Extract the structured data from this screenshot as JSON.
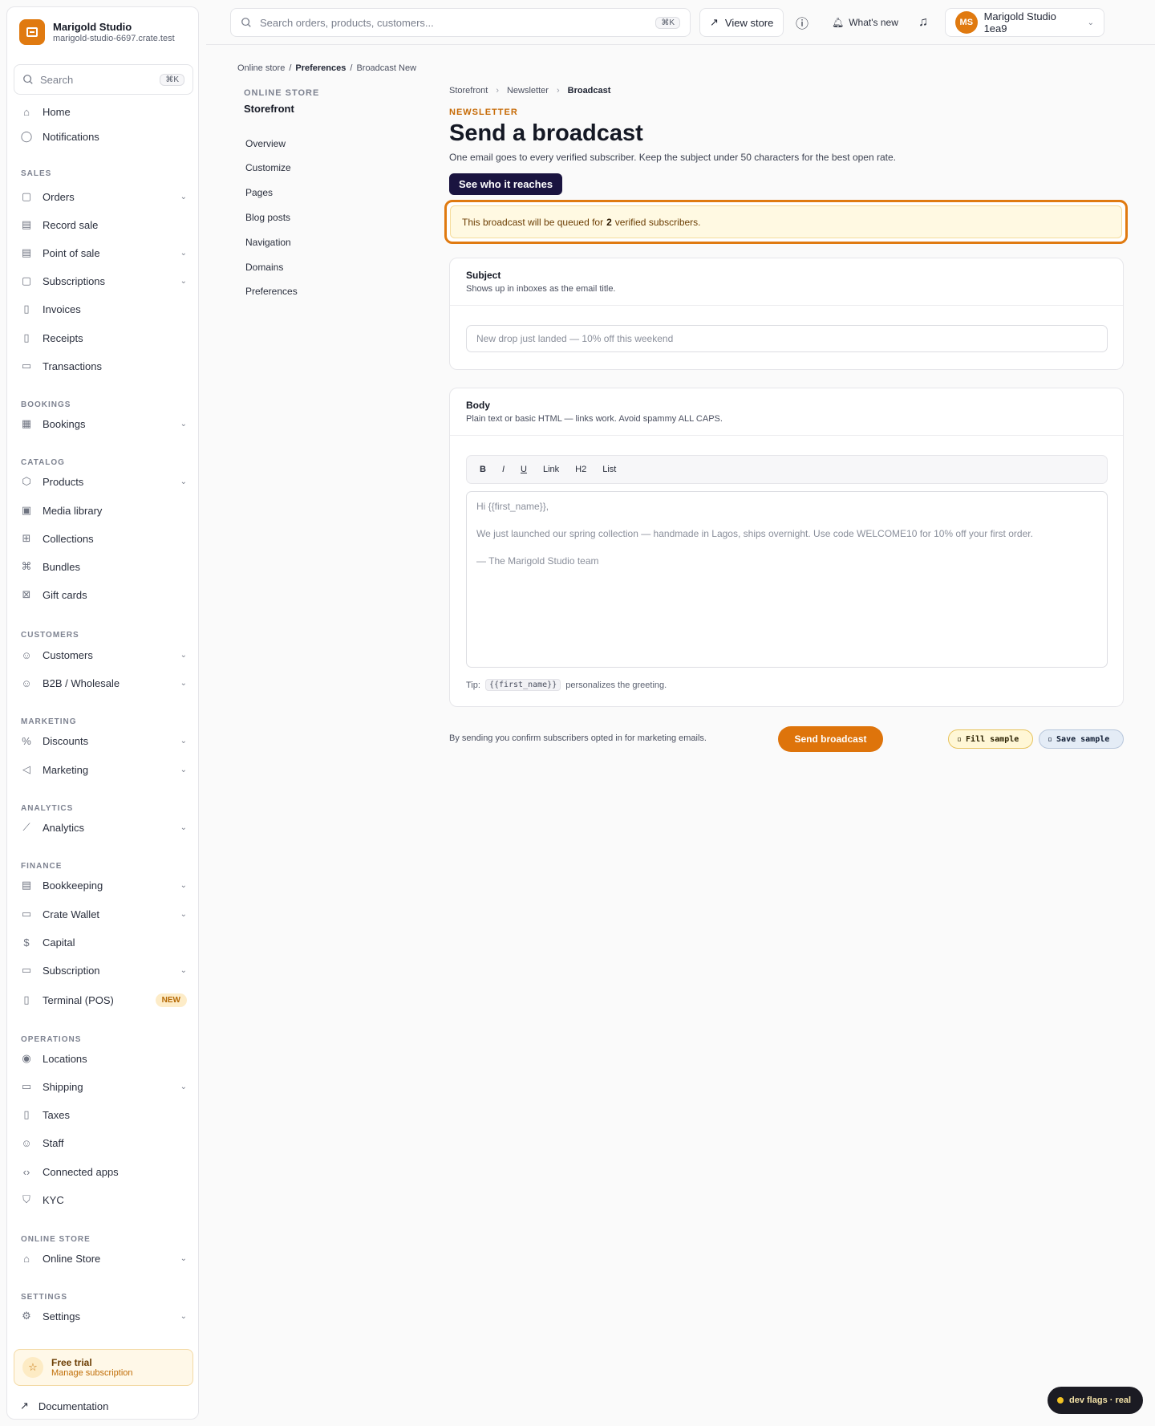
{
  "brand": {
    "name": "Marigold Studio",
    "domain": "marigold-studio-6697.crate.test"
  },
  "sidebar": {
    "search_placeholder": "Search",
    "search_shortcut": "⌘K",
    "items": [
      {
        "label": "Home",
        "icon": "home-icon"
      },
      {
        "label": "Notifications",
        "icon": "chat-icon"
      },
      {
        "label": "Orders",
        "icon": "bag-icon"
      },
      {
        "label": "Record sale",
        "icon": "receipt-icon"
      },
      {
        "label": "Point of sale",
        "icon": "receipt-icon"
      },
      {
        "label": "Subscriptions",
        "icon": "bag-icon"
      },
      {
        "label": "Invoices",
        "icon": "document-icon"
      },
      {
        "label": "Receipts",
        "icon": "document-icon"
      },
      {
        "label": "Transactions",
        "icon": "card-icon"
      },
      {
        "label": "Bookings",
        "icon": "calendar-icon"
      },
      {
        "label": "Products",
        "icon": "box-icon"
      },
      {
        "label": "Media library",
        "icon": "image-icon"
      },
      {
        "label": "Collections",
        "icon": "grid-icon"
      },
      {
        "label": "Bundles",
        "icon": "bundle-icon"
      },
      {
        "label": "Gift cards",
        "icon": "gift-icon"
      },
      {
        "label": "Customers",
        "icon": "users-icon"
      },
      {
        "label": "B2B / Wholesale",
        "icon": "users-icon"
      },
      {
        "label": "Discounts",
        "icon": "discount-icon"
      },
      {
        "label": "Marketing",
        "icon": "megaphone-icon"
      },
      {
        "label": "Analytics",
        "icon": "chart-icon"
      },
      {
        "label": "Bookkeeping",
        "icon": "ledger-icon"
      },
      {
        "label": "Crate Wallet",
        "icon": "wallet-icon"
      },
      {
        "label": "Capital",
        "icon": "dollar-icon"
      },
      {
        "label": "Subscription",
        "icon": "card-icon"
      },
      {
        "label": "Terminal (POS)",
        "icon": "terminal-icon",
        "badge": "NEW"
      },
      {
        "label": "Locations",
        "icon": "pin-icon"
      },
      {
        "label": "Shipping",
        "icon": "truck-icon"
      },
      {
        "label": "Taxes",
        "icon": "document-icon"
      },
      {
        "label": "Staff",
        "icon": "user-plus-icon"
      },
      {
        "label": "Connected apps",
        "icon": "code-icon"
      },
      {
        "label": "KYC",
        "icon": "shield-icon"
      },
      {
        "label": "Online Store",
        "icon": "store-icon"
      },
      {
        "label": "Settings",
        "icon": "gear-icon"
      }
    ],
    "sections": [
      "SALES",
      "BOOKINGS",
      "CATALOG",
      "CUSTOMERS",
      "MARKETING",
      "ANALYTICS",
      "FINANCE",
      "OPERATIONS",
      "ONLINE STORE",
      "SETTINGS"
    ],
    "trial": {
      "title": "Free trial",
      "subtitle": "Manage subscription"
    },
    "docs": "Documentation"
  },
  "topbar": {
    "search_placeholder": "Search orders, products, customers...",
    "search_shortcut": "⌘K",
    "view_store": "View store",
    "whats_new": "What's new",
    "account_initials": "MS",
    "account_name": "Marigold Studio 1ea9"
  },
  "breadcrumb_top": [
    "Online store",
    "Preferences",
    "Broadcast New"
  ],
  "subnav": {
    "heading": "ONLINE STORE",
    "title": "Storefront",
    "items": [
      "Overview",
      "Customize",
      "Pages",
      "Blog posts",
      "Navigation",
      "Domains",
      "Preferences"
    ]
  },
  "main": {
    "breadcrumb": [
      "Storefront",
      "Newsletter",
      "Broadcast"
    ],
    "eyebrow": "NEWSLETTER",
    "title": "Send a broadcast",
    "subtitle": "One email goes to every verified subscriber. Keep the subject under 50 characters for the best open rate.",
    "reach_button": "See who it reaches",
    "notice_pre": "This broadcast will be queued for",
    "notice_count": "2",
    "notice_post": "verified subscribers.",
    "subject": {
      "title": "Subject",
      "hint": "Shows up in inboxes as the email title.",
      "placeholder": "New drop just landed — 10% off this weekend"
    },
    "body": {
      "title": "Body",
      "hint": "Plain text or basic HTML — links work. Avoid spammy ALL CAPS.",
      "toolbar": [
        "B",
        "I",
        "U",
        "Link",
        "H2",
        "List"
      ],
      "lines": [
        "Hi {{first_name}},",
        "We just launched our spring collection — handmade in Lagos, ships overnight. Use code WELCOME10 for 10% off your first order.",
        "— The Marigold Studio team"
      ],
      "tip_pre": "Tip:",
      "tip_code": "{{first_name}}",
      "tip_post": "personalizes the greeting."
    },
    "footer_note": "By sending you confirm subscribers opted in for marketing emails.",
    "send_button": "Send broadcast",
    "fill_sample": "Fill sample",
    "save_sample": "Save sample"
  },
  "devflags": "dev flags · real",
  "colors": {
    "accent": "#e07a10",
    "navy": "#1a1440"
  }
}
